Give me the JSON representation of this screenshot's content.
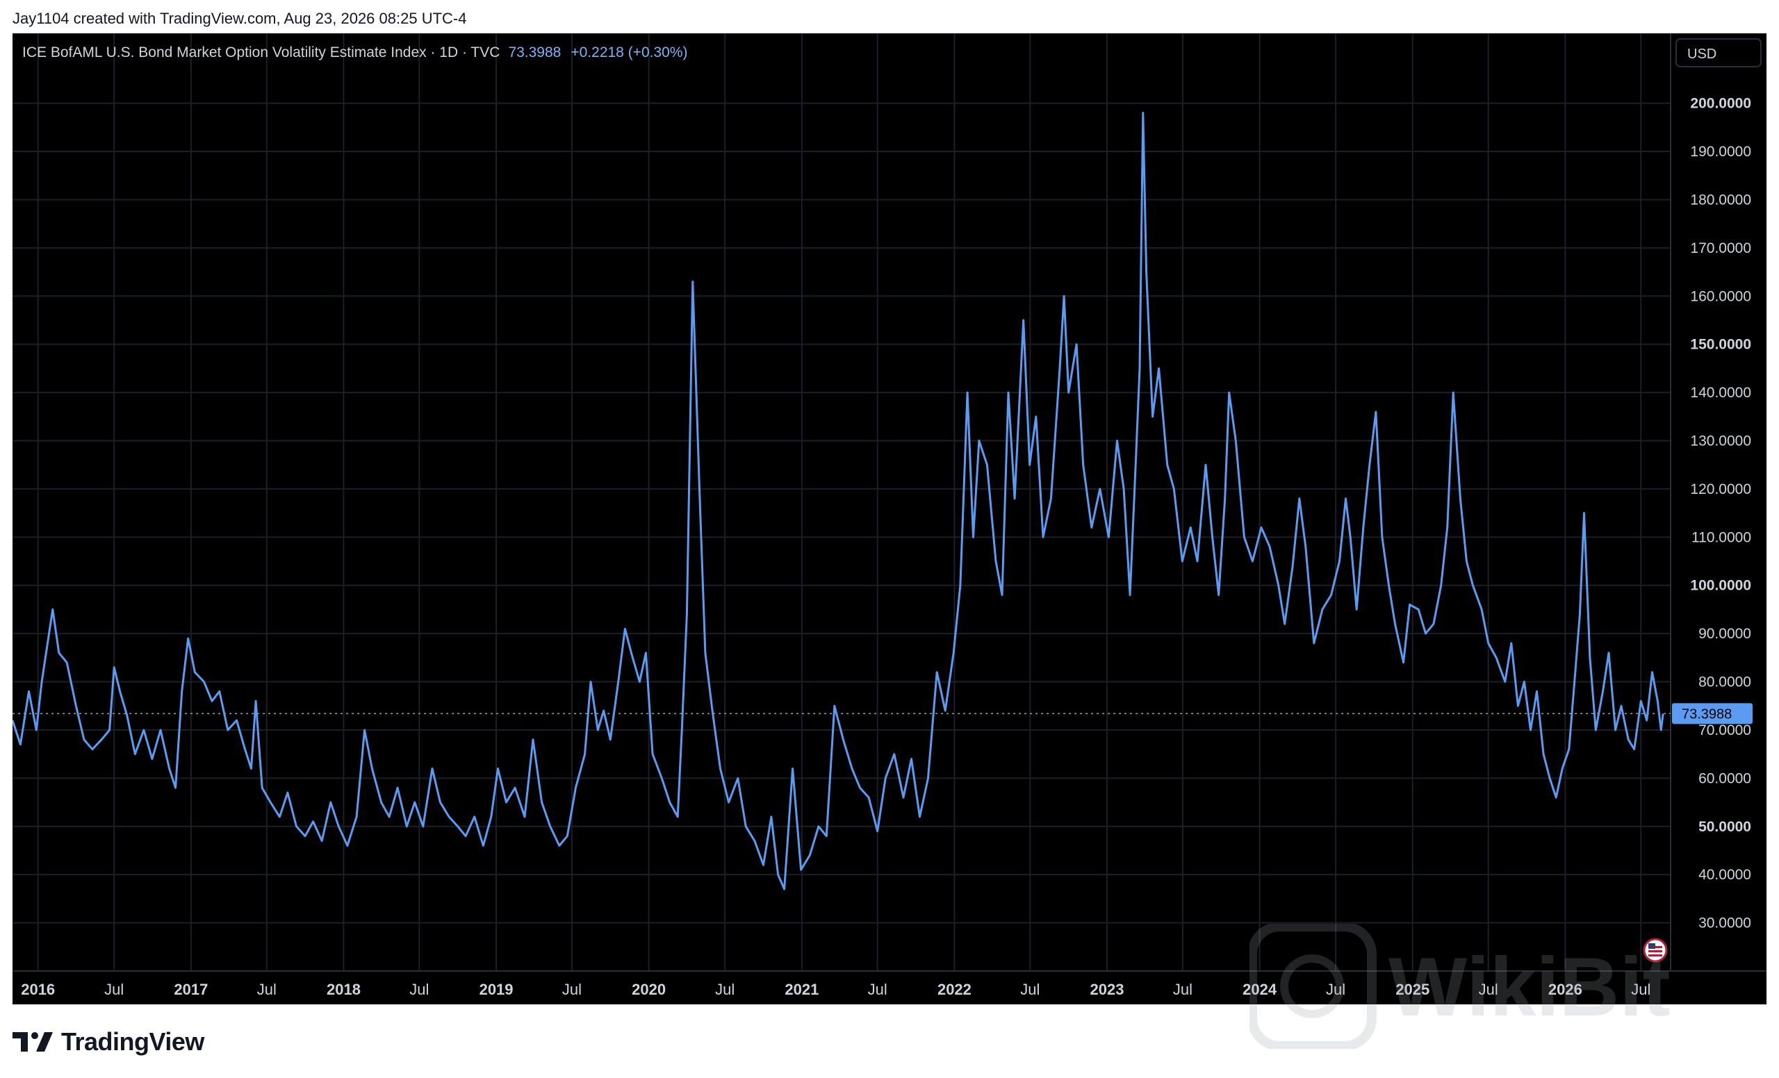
{
  "header": {
    "caption": "Jay1104 created with TradingView.com, Aug 23, 2026 08:25 UTC-4"
  },
  "legend": {
    "symbol_text": "ICE BofAML U.S. Bond Market Option Volatility Estimate Index · 1D · TVC",
    "last_value": "73.3988",
    "change": "+0.2218 (+0.30%)"
  },
  "currency_button": "USD",
  "price_tag": "73.3988",
  "footer": {
    "brand": "TradingView"
  },
  "watermark": {
    "text": "WikiBit"
  },
  "colors": {
    "background": "#000000",
    "line": "#5b9cf2",
    "legend_value": "#7fb2f5",
    "grid": "#1c1f26",
    "axis_text": "#d1d4dc",
    "price_tag_bg": "#5b9cf2"
  },
  "chart_data": {
    "type": "line",
    "title": "ICE BofAML U.S. Bond Market Option Volatility Estimate Index · 1D · TVC",
    "xlabel": "",
    "ylabel": "",
    "ylim": [
      20,
      214.5
    ],
    "xlim": [
      "2015-11-01",
      "2026-09-10"
    ],
    "y_ticks": [
      30,
      40,
      50,
      60,
      70,
      80,
      90,
      100,
      110,
      120,
      130,
      140,
      150,
      160,
      170,
      180,
      190,
      200
    ],
    "y_tick_labels": [
      "30.0000",
      "40.0000",
      "50.0000",
      "60.0000",
      "70.0000",
      "80.0000",
      "90.0000",
      "100.0000",
      "110.0000",
      "120.0000",
      "130.0000",
      "140.0000",
      "150.0000",
      "160.0000",
      "170.0000",
      "180.0000",
      "190.0000",
      "200.0000"
    ],
    "y_bold_ticks": [
      50,
      100,
      150,
      200
    ],
    "x_ticks": [
      {
        "date": "2016-01-01",
        "label": "2016",
        "bold": true
      },
      {
        "date": "2016-07-01",
        "label": "Jul",
        "bold": false
      },
      {
        "date": "2017-01-01",
        "label": "2017",
        "bold": true
      },
      {
        "date": "2017-07-01",
        "label": "Jul",
        "bold": false
      },
      {
        "date": "2018-01-01",
        "label": "2018",
        "bold": true
      },
      {
        "date": "2018-07-01",
        "label": "Jul",
        "bold": false
      },
      {
        "date": "2019-01-01",
        "label": "2019",
        "bold": true
      },
      {
        "date": "2019-07-01",
        "label": "Jul",
        "bold": false
      },
      {
        "date": "2020-01-01",
        "label": "2020",
        "bold": true
      },
      {
        "date": "2020-07-01",
        "label": "Jul",
        "bold": false
      },
      {
        "date": "2021-01-01",
        "label": "2021",
        "bold": true
      },
      {
        "date": "2021-07-01",
        "label": "Jul",
        "bold": false
      },
      {
        "date": "2022-01-01",
        "label": "2022",
        "bold": true
      },
      {
        "date": "2022-07-01",
        "label": "Jul",
        "bold": false
      },
      {
        "date": "2023-01-01",
        "label": "2023",
        "bold": true
      },
      {
        "date": "2023-07-01",
        "label": "Jul",
        "bold": false
      },
      {
        "date": "2024-01-01",
        "label": "2024",
        "bold": true
      },
      {
        "date": "2024-07-01",
        "label": "Jul",
        "bold": false
      },
      {
        "date": "2025-01-01",
        "label": "2025",
        "bold": true
      },
      {
        "date": "2025-07-01",
        "label": "Jul",
        "bold": false
      },
      {
        "date": "2026-01-01",
        "label": "2026",
        "bold": true
      },
      {
        "date": "2026-07-01",
        "label": "Jul",
        "bold": false
      }
    ],
    "last_value": 73.3988,
    "grid": true,
    "series": [
      {
        "name": "ICE BofAML U.S. Bond Market Option Volatility Estimate Index",
        "points": [
          [
            "2015-11-01",
            72
          ],
          [
            "2015-11-20",
            67
          ],
          [
            "2015-12-10",
            78
          ],
          [
            "2015-12-28",
            70
          ],
          [
            "2016-01-10",
            80
          ],
          [
            "2016-02-05",
            95
          ],
          [
            "2016-02-20",
            86
          ],
          [
            "2016-03-10",
            84
          ],
          [
            "2016-04-01",
            75
          ],
          [
            "2016-04-20",
            68
          ],
          [
            "2016-05-10",
            66
          ],
          [
            "2016-06-01",
            68
          ],
          [
            "2016-06-20",
            70
          ],
          [
            "2016-07-01",
            83
          ],
          [
            "2016-07-15",
            78
          ],
          [
            "2016-08-01",
            73
          ],
          [
            "2016-08-20",
            65
          ],
          [
            "2016-09-10",
            70
          ],
          [
            "2016-09-30",
            64
          ],
          [
            "2016-10-20",
            70
          ],
          [
            "2016-11-10",
            62
          ],
          [
            "2016-11-25",
            58
          ],
          [
            "2016-12-10",
            78
          ],
          [
            "2016-12-25",
            89
          ],
          [
            "2017-01-10",
            82
          ],
          [
            "2017-02-01",
            80
          ],
          [
            "2017-02-20",
            76
          ],
          [
            "2017-03-10",
            78
          ],
          [
            "2017-03-30",
            70
          ],
          [
            "2017-04-20",
            72
          ],
          [
            "2017-05-10",
            66
          ],
          [
            "2017-05-25",
            62
          ],
          [
            "2017-06-05",
            76
          ],
          [
            "2017-06-20",
            58
          ],
          [
            "2017-07-10",
            55
          ],
          [
            "2017-08-01",
            52
          ],
          [
            "2017-08-20",
            57
          ],
          [
            "2017-09-10",
            50
          ],
          [
            "2017-10-01",
            48
          ],
          [
            "2017-10-20",
            51
          ],
          [
            "2017-11-10",
            47
          ],
          [
            "2017-12-01",
            55
          ],
          [
            "2017-12-20",
            50
          ],
          [
            "2018-01-10",
            46
          ],
          [
            "2018-02-01",
            52
          ],
          [
            "2018-02-20",
            70
          ],
          [
            "2018-03-10",
            62
          ],
          [
            "2018-04-01",
            55
          ],
          [
            "2018-04-20",
            52
          ],
          [
            "2018-05-10",
            58
          ],
          [
            "2018-06-01",
            50
          ],
          [
            "2018-06-20",
            55
          ],
          [
            "2018-07-10",
            50
          ],
          [
            "2018-08-01",
            62
          ],
          [
            "2018-08-20",
            55
          ],
          [
            "2018-09-10",
            52
          ],
          [
            "2018-10-01",
            50
          ],
          [
            "2018-10-20",
            48
          ],
          [
            "2018-11-10",
            52
          ],
          [
            "2018-12-01",
            46
          ],
          [
            "2018-12-20",
            52
          ],
          [
            "2019-01-05",
            62
          ],
          [
            "2019-01-25",
            55
          ],
          [
            "2019-02-15",
            58
          ],
          [
            "2019-03-10",
            52
          ],
          [
            "2019-03-30",
            68
          ],
          [
            "2019-04-20",
            55
          ],
          [
            "2019-05-10",
            50
          ],
          [
            "2019-06-01",
            46
          ],
          [
            "2019-06-20",
            48
          ],
          [
            "2019-07-10",
            58
          ],
          [
            "2019-08-01",
            65
          ],
          [
            "2019-08-15",
            80
          ],
          [
            "2019-09-01",
            70
          ],
          [
            "2019-09-15",
            74
          ],
          [
            "2019-10-01",
            68
          ],
          [
            "2019-10-20",
            80
          ],
          [
            "2019-11-05",
            91
          ],
          [
            "2019-11-20",
            86
          ],
          [
            "2019-12-10",
            80
          ],
          [
            "2019-12-25",
            86
          ],
          [
            "2020-01-10",
            65
          ],
          [
            "2020-02-01",
            60
          ],
          [
            "2020-02-20",
            55
          ],
          [
            "2020-03-10",
            52
          ],
          [
            "2020-03-20",
            70
          ],
          [
            "2020-04-01",
            94
          ],
          [
            "2020-04-15",
            163
          ],
          [
            "2020-05-01",
            120
          ],
          [
            "2020-05-15",
            86
          ],
          [
            "2020-06-01",
            74
          ],
          [
            "2020-06-20",
            62
          ],
          [
            "2020-07-10",
            55
          ],
          [
            "2020-08-01",
            60
          ],
          [
            "2020-08-20",
            50
          ],
          [
            "2020-09-10",
            47
          ],
          [
            "2020-10-01",
            42
          ],
          [
            "2020-10-20",
            52
          ],
          [
            "2020-11-05",
            40
          ],
          [
            "2020-11-20",
            37
          ],
          [
            "2020-12-10",
            62
          ],
          [
            "2020-12-30",
            41
          ],
          [
            "2021-01-20",
            44
          ],
          [
            "2021-02-10",
            50
          ],
          [
            "2021-03-01",
            48
          ],
          [
            "2021-03-20",
            75
          ],
          [
            "2021-04-10",
            68
          ],
          [
            "2021-05-01",
            62
          ],
          [
            "2021-05-20",
            58
          ],
          [
            "2021-06-10",
            56
          ],
          [
            "2021-07-01",
            49
          ],
          [
            "2021-07-20",
            60
          ],
          [
            "2021-08-10",
            65
          ],
          [
            "2021-09-01",
            56
          ],
          [
            "2021-09-20",
            64
          ],
          [
            "2021-10-10",
            52
          ],
          [
            "2021-10-30",
            60
          ],
          [
            "2021-11-20",
            82
          ],
          [
            "2021-12-10",
            74
          ],
          [
            "2021-12-30",
            86
          ],
          [
            "2022-01-15",
            100
          ],
          [
            "2022-02-01",
            140
          ],
          [
            "2022-02-15",
            110
          ],
          [
            "2022-03-01",
            130
          ],
          [
            "2022-03-20",
            125
          ],
          [
            "2022-04-10",
            105
          ],
          [
            "2022-04-25",
            98
          ],
          [
            "2022-05-10",
            140
          ],
          [
            "2022-05-25",
            118
          ],
          [
            "2022-06-15",
            155
          ],
          [
            "2022-06-30",
            125
          ],
          [
            "2022-07-15",
            135
          ],
          [
            "2022-08-01",
            110
          ],
          [
            "2022-08-20",
            118
          ],
          [
            "2022-09-10",
            145
          ],
          [
            "2022-09-20",
            160
          ],
          [
            "2022-10-01",
            140
          ],
          [
            "2022-10-20",
            150
          ],
          [
            "2022-11-05",
            125
          ],
          [
            "2022-11-25",
            112
          ],
          [
            "2022-12-15",
            120
          ],
          [
            "2023-01-05",
            110
          ],
          [
            "2023-01-25",
            130
          ],
          [
            "2023-02-10",
            120
          ],
          [
            "2023-02-25",
            98
          ],
          [
            "2023-03-10",
            124
          ],
          [
            "2023-03-20",
            145
          ],
          [
            "2023-03-28",
            198
          ],
          [
            "2023-04-05",
            165
          ],
          [
            "2023-04-20",
            135
          ],
          [
            "2023-05-05",
            145
          ],
          [
            "2023-05-25",
            125
          ],
          [
            "2023-06-10",
            120
          ],
          [
            "2023-06-30",
            105
          ],
          [
            "2023-07-20",
            112
          ],
          [
            "2023-08-05",
            105
          ],
          [
            "2023-08-25",
            125
          ],
          [
            "2023-09-10",
            110
          ],
          [
            "2023-09-25",
            98
          ],
          [
            "2023-10-10",
            118
          ],
          [
            "2023-10-20",
            140
          ],
          [
            "2023-11-05",
            130
          ],
          [
            "2023-11-25",
            110
          ],
          [
            "2023-12-15",
            105
          ],
          [
            "2024-01-05",
            112
          ],
          [
            "2024-01-25",
            108
          ],
          [
            "2024-02-15",
            100
          ],
          [
            "2024-03-01",
            92
          ],
          [
            "2024-03-20",
            104
          ],
          [
            "2024-04-05",
            118
          ],
          [
            "2024-04-20",
            108
          ],
          [
            "2024-05-10",
            88
          ],
          [
            "2024-05-30",
            95
          ],
          [
            "2024-06-20",
            98
          ],
          [
            "2024-07-10",
            105
          ],
          [
            "2024-07-25",
            118
          ],
          [
            "2024-08-05",
            110
          ],
          [
            "2024-08-20",
            95
          ],
          [
            "2024-09-05",
            112
          ],
          [
            "2024-09-20",
            125
          ],
          [
            "2024-10-05",
            136
          ],
          [
            "2024-10-20",
            110
          ],
          [
            "2024-11-05",
            100
          ],
          [
            "2024-11-20",
            92
          ],
          [
            "2024-12-10",
            84
          ],
          [
            "2024-12-25",
            96
          ],
          [
            "2025-01-15",
            95
          ],
          [
            "2025-02-01",
            90
          ],
          [
            "2025-02-20",
            92
          ],
          [
            "2025-03-10",
            100
          ],
          [
            "2025-03-25",
            112
          ],
          [
            "2025-04-08",
            140
          ],
          [
            "2025-04-25",
            118
          ],
          [
            "2025-05-10",
            105
          ],
          [
            "2025-05-25",
            100
          ],
          [
            "2025-06-15",
            95
          ],
          [
            "2025-07-01",
            88
          ],
          [
            "2025-07-20",
            85
          ],
          [
            "2025-08-10",
            80
          ],
          [
            "2025-08-25",
            88
          ],
          [
            "2025-09-10",
            75
          ],
          [
            "2025-09-25",
            80
          ],
          [
            "2025-10-10",
            70
          ],
          [
            "2025-10-25",
            78
          ],
          [
            "2025-11-10",
            65
          ],
          [
            "2025-11-25",
            60
          ],
          [
            "2025-12-10",
            56
          ],
          [
            "2025-12-25",
            62
          ],
          [
            "2026-01-10",
            66
          ],
          [
            "2026-01-25",
            82
          ],
          [
            "2026-02-05",
            94
          ],
          [
            "2026-02-15",
            115
          ],
          [
            "2026-03-01",
            85
          ],
          [
            "2026-03-15",
            70
          ],
          [
            "2026-04-01",
            78
          ],
          [
            "2026-04-15",
            86
          ],
          [
            "2026-05-01",
            70
          ],
          [
            "2026-05-15",
            75
          ],
          [
            "2026-06-01",
            68
          ],
          [
            "2026-06-15",
            66
          ],
          [
            "2026-07-01",
            76
          ],
          [
            "2026-07-15",
            72
          ],
          [
            "2026-07-28",
            82
          ],
          [
            "2026-08-10",
            76
          ],
          [
            "2026-08-18",
            70
          ],
          [
            "2026-08-23",
            73.4
          ]
        ]
      }
    ]
  }
}
